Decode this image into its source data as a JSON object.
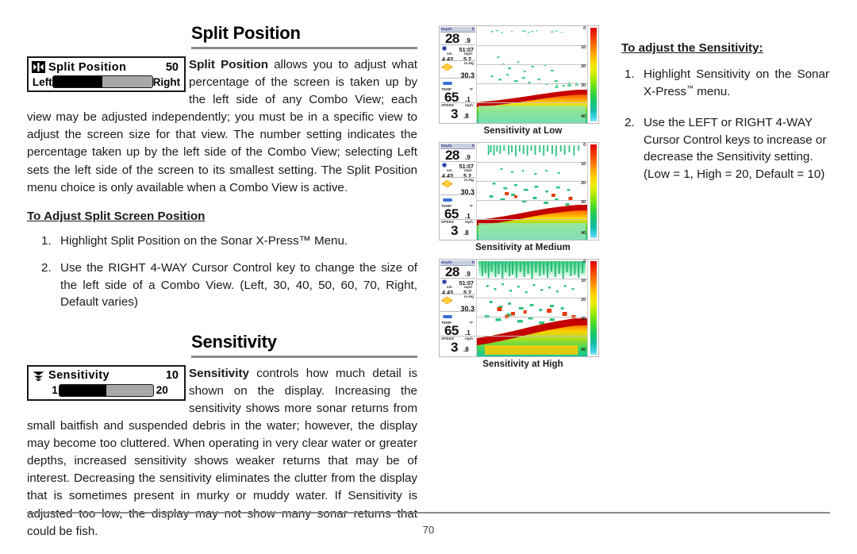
{
  "page": {
    "number": "70"
  },
  "split_position": {
    "heading": "Split Position",
    "widget": {
      "icon": "left-right-arrows-icon",
      "title": "Split Position",
      "value": "50",
      "left_label": "Left",
      "right_label": "Right",
      "fill_percent": 50
    },
    "paragraph_lead": "Split Position",
    "paragraph_rest": " allows you to adjust what percentage of the screen is taken up by the left side of any Combo View; each view may be adjusted independently; you must be in a specific view to adjust the screen size for that view. The number setting indicates the percentage taken up by the left side of the Combo View; selecting Left sets the left side of the screen to its smallest setting. The Split Position menu choice is only available when a Combo View is active.",
    "sub_heading": "To Adjust Split Screen Position",
    "steps": [
      {
        "num": "1.",
        "text": "Highlight Split Position on the Sonar X-Press™ Menu."
      },
      {
        "num": "2.",
        "text": "Use the RIGHT 4-WAY Cursor Control key to change the size of the left side of a Combo View. (Left, 30, 40, 50, 60, 70, Right, Default varies)"
      }
    ]
  },
  "sensitivity": {
    "heading": "Sensitivity",
    "widget": {
      "icon": "sonar-waves-icon",
      "title": "Sensitivity",
      "value": "10",
      "left_label": "1",
      "right_label": "20",
      "fill_percent": 50
    },
    "paragraph_lead": "Sensitivity",
    "paragraph_rest": " controls how much detail is shown on the display. Increasing the sensitivity shows more sonar returns from small baitfish and suspended debris in the water; however, the display may become too cluttered. When operating in very clear water or greater depths, increased sensitivity shows weaker returns that may be of interest. Decreasing the sensitivity eliminates the clutter from the display that is sometimes present in murky or muddy water. If Sensitivity is adjusted too low, the display may not show many sonar returns that could be fish."
  },
  "right_column": {
    "heading": "To adjust the Sensitivity:",
    "steps": [
      {
        "num": "1.",
        "text_a": "Highlight Sensitivity on the Sonar X-Press",
        "tm": "™",
        "text_b": " menu."
      },
      {
        "num": "2.",
        "text": "Use the LEFT or RIGHT 4-WAY Cursor Control keys to increase or decrease the Sensitivity setting. (Low = 1, High = 20, Default = 10)"
      }
    ]
  },
  "figures": [
    {
      "caption": "Sensitivity at Low",
      "panel": {
        "depth_label": "Depth",
        "depth_unit": "ft",
        "depth_value": "28",
        "depth_decimal": ".9",
        "time_value": "51:07",
        "dist_label": "sm",
        "speed_label": "mph",
        "dist_value": "4.43",
        "speed_value": "5.2",
        "pressure_unit": "in.Hg",
        "pressure_value": "30.3",
        "temp_label": "TEMP",
        "temp_unit": "°F",
        "temp_value": "65",
        "temp_decimal": ".1",
        "speed_title": "SPEED",
        "speed_unit": "mph",
        "speed_big": "3",
        "speed_dec": ".8"
      },
      "depth_ticks": [
        "0",
        "10",
        "20",
        "30",
        "40"
      ]
    },
    {
      "caption": "Sensitivity at Medium",
      "panel": {
        "depth_label": "Depth",
        "depth_unit": "ft",
        "depth_value": "28",
        "depth_decimal": ".9",
        "time_value": "51:07",
        "dist_label": "sm",
        "speed_label": "mph",
        "dist_value": "4.43",
        "speed_value": "5.2",
        "pressure_unit": "in.Hg",
        "pressure_value": "30.3",
        "temp_label": "TEMP",
        "temp_unit": "°F",
        "temp_value": "65",
        "temp_decimal": ".1",
        "speed_title": "SPEED",
        "speed_unit": "mph",
        "speed_big": "3",
        "speed_dec": ".8"
      },
      "depth_ticks": [
        "0",
        "10",
        "20",
        "30",
        "40"
      ]
    },
    {
      "caption": "Sensitivity at High",
      "panel": {
        "depth_label": "Depth",
        "depth_unit": "ft",
        "depth_value": "28",
        "depth_decimal": ".9",
        "time_value": "51:07",
        "dist_label": "sm",
        "speed_label": "mph",
        "dist_value": "4.43",
        "speed_value": "5.2",
        "pressure_unit": "in.Hg",
        "pressure_value": "30.3",
        "temp_label": "TEMP",
        "temp_unit": "°F",
        "temp_value": "65",
        "temp_decimal": ".1",
        "speed_title": "SPEED",
        "speed_unit": "mph",
        "speed_big": "3",
        "speed_dec": ".8"
      },
      "depth_ticks": [
        "0",
        "10",
        "20",
        "30",
        "40"
      ]
    }
  ]
}
